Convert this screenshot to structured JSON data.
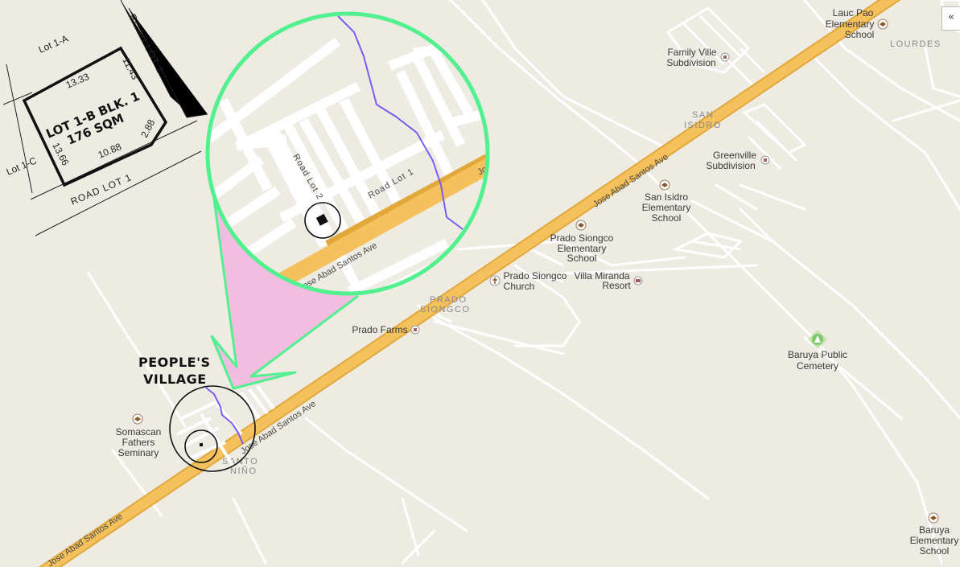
{
  "ui": {
    "collapse_button": "«"
  },
  "highway": {
    "name": "Jose Abad Santos Ave"
  },
  "plan": {
    "lot_title": "LOT 1-B BLK. 1",
    "lot_area": "176 SQM",
    "lot_1a": "Lot 1-A",
    "lot_1c": "Lot 1-C",
    "road_lot_1": "ROAD LOT 1",
    "road_lot_2": "ROAD LOT 2",
    "dim_top": "13.33",
    "dim_right": "11.43",
    "dim_corner": "2.88",
    "dim_bottom": "10.88",
    "dim_left": "13.66"
  },
  "zoom": {
    "road_lot_1": "Road Lot 1",
    "road_lot_2": "Road Lot 2",
    "highway": "Jose Abad Santos Ave",
    "highway_cut": "Jo"
  },
  "callout": {
    "title_line1": "PEOPLE'S",
    "title_line2": "VILLAGE"
  },
  "areas": {
    "lourdes": "LOURDES",
    "san_isidro_1": "SAN",
    "san_isidro_2": "ISIDRO",
    "prado_siongco_1": "PRADO",
    "prado_siongco_2": "SIONGCO",
    "santo_nino_1": "SANTO",
    "santo_nino_2": "NIÑO"
  },
  "places": {
    "lauc_pao": [
      "Lauc Pao",
      "Elementary",
      "School"
    ],
    "family_ville": [
      "Family Ville",
      "Subdivision"
    ],
    "greenville": [
      "Greenville",
      "Subdivision"
    ],
    "san_isidro_school": [
      "San Isidro",
      "Elementary",
      "School"
    ],
    "prado_school": [
      "Prado Siongco",
      "Elementary",
      "School"
    ],
    "prado_church": [
      "Prado Siongco",
      "Church"
    ],
    "villa_miranda": [
      "Villa Miranda",
      "Resort"
    ],
    "prado_farms": [
      "Prado Farms"
    ],
    "baruya_cemetery": [
      "Baruya Public",
      "Cemetery"
    ],
    "baruya_school": [
      "Baruya",
      "Elementary",
      "School"
    ],
    "somascan": [
      "Somascan",
      "Fathers",
      "Seminary"
    ]
  },
  "colors": {
    "background": "#eeebe3",
    "highway": "#f5c15c",
    "highway_edge": "#e2a83a",
    "road": "#ffffff",
    "callout_ring": "#52f08f",
    "callout_fill": "#f3bde1",
    "creek": "#7b5cf0",
    "park": "#7fc86f"
  }
}
